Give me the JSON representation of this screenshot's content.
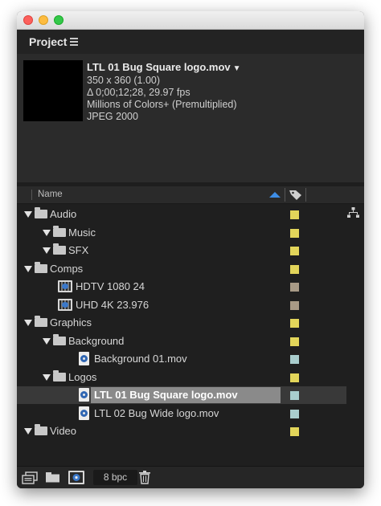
{
  "panel": {
    "title": "Project"
  },
  "preview": {
    "clip_name": "LTL 01 Bug Square logo.mov",
    "caret": "▼",
    "meta": [
      "350 x 360 (1.00)",
      "Δ 0;00;12;28, 29.97 fps",
      "Millions of Colors+ (Premultiplied)",
      "JPEG 2000"
    ]
  },
  "search": {
    "placeholder": "",
    "icon": "search-icon"
  },
  "columns": {
    "name": "Name",
    "sort": "ascending",
    "label_icon": "tag-icon"
  },
  "colors": {
    "folder_label": "#e2d55a",
    "comp_label": "#a89a86",
    "footage_label": "#a9cdcd",
    "sort_arrow": "#3e8ee6"
  },
  "items": [
    {
      "label": "Audio",
      "type": "folder",
      "level": 0,
      "expanded": true,
      "swatch": "#e2d55a",
      "selected": false
    },
    {
      "label": "Music",
      "type": "folder",
      "level": 1,
      "expanded": true,
      "swatch": "#e2d55a",
      "selected": false
    },
    {
      "label": "SFX",
      "type": "folder",
      "level": 1,
      "expanded": true,
      "swatch": "#e2d55a",
      "selected": false
    },
    {
      "label": "Comps",
      "type": "folder",
      "level": 0,
      "expanded": true,
      "swatch": "#e2d55a",
      "selected": false
    },
    {
      "label": "HDTV 1080 24",
      "type": "comp",
      "level": 1,
      "expanded": false,
      "swatch": "#a89a86",
      "selected": false
    },
    {
      "label": "UHD 4K 23.976",
      "type": "comp",
      "level": 1,
      "expanded": false,
      "swatch": "#a89a86",
      "selected": false
    },
    {
      "label": "Graphics",
      "type": "folder",
      "level": 0,
      "expanded": true,
      "swatch": "#e2d55a",
      "selected": false
    },
    {
      "label": "Background",
      "type": "folder",
      "level": 1,
      "expanded": true,
      "swatch": "#e2d55a",
      "selected": false
    },
    {
      "label": "Background 01.mov",
      "type": "footage",
      "level": 2,
      "expanded": false,
      "swatch": "#a9cdcd",
      "selected": false
    },
    {
      "label": "Logos",
      "type": "folder",
      "level": 1,
      "expanded": true,
      "swatch": "#e2d55a",
      "selected": false
    },
    {
      "label": "LTL 01 Bug Square logo.mov",
      "type": "footage",
      "level": 2,
      "expanded": false,
      "swatch": "#a9cdcd",
      "selected": true
    },
    {
      "label": "LTL 02 Bug Wide logo.mov",
      "type": "footage",
      "level": 2,
      "expanded": false,
      "swatch": "#a9cdcd",
      "selected": false
    },
    {
      "label": "Video",
      "type": "folder",
      "level": 0,
      "expanded": true,
      "swatch": "#e2d55a",
      "selected": false
    }
  ],
  "footer": {
    "bpc": "8 bpc"
  }
}
